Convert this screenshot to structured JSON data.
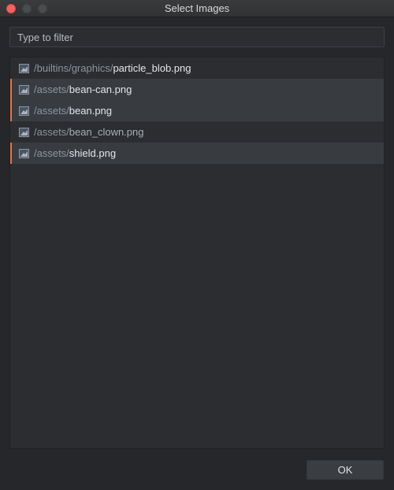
{
  "window": {
    "title": "Select Images",
    "controls": {
      "close": "close-button",
      "minimize": "minimize-button",
      "zoom": "zoom-button"
    }
  },
  "filter": {
    "placeholder": "Type to filter",
    "value": ""
  },
  "items": [
    {
      "dir": "/builtins/graphics/",
      "file": "particle_blob.png",
      "selected": false,
      "icon": "image-icon"
    },
    {
      "dir": "/assets/",
      "file": "bean-can.png",
      "selected": true,
      "icon": "image-icon"
    },
    {
      "dir": "/assets/",
      "file": "bean.png",
      "selected": true,
      "icon": "image-icon"
    },
    {
      "dir": "/assets/",
      "file": "bean_clown.png",
      "selected": false,
      "icon": "image-icon"
    },
    {
      "dir": "/assets/",
      "file": "shield.png",
      "selected": true,
      "icon": "image-icon"
    }
  ],
  "footer": {
    "ok_label": "OK"
  },
  "colors": {
    "accent": "#f26e3a",
    "background": "#25272b",
    "list_background": "#2b2d31",
    "selected_row": "#383c41"
  }
}
